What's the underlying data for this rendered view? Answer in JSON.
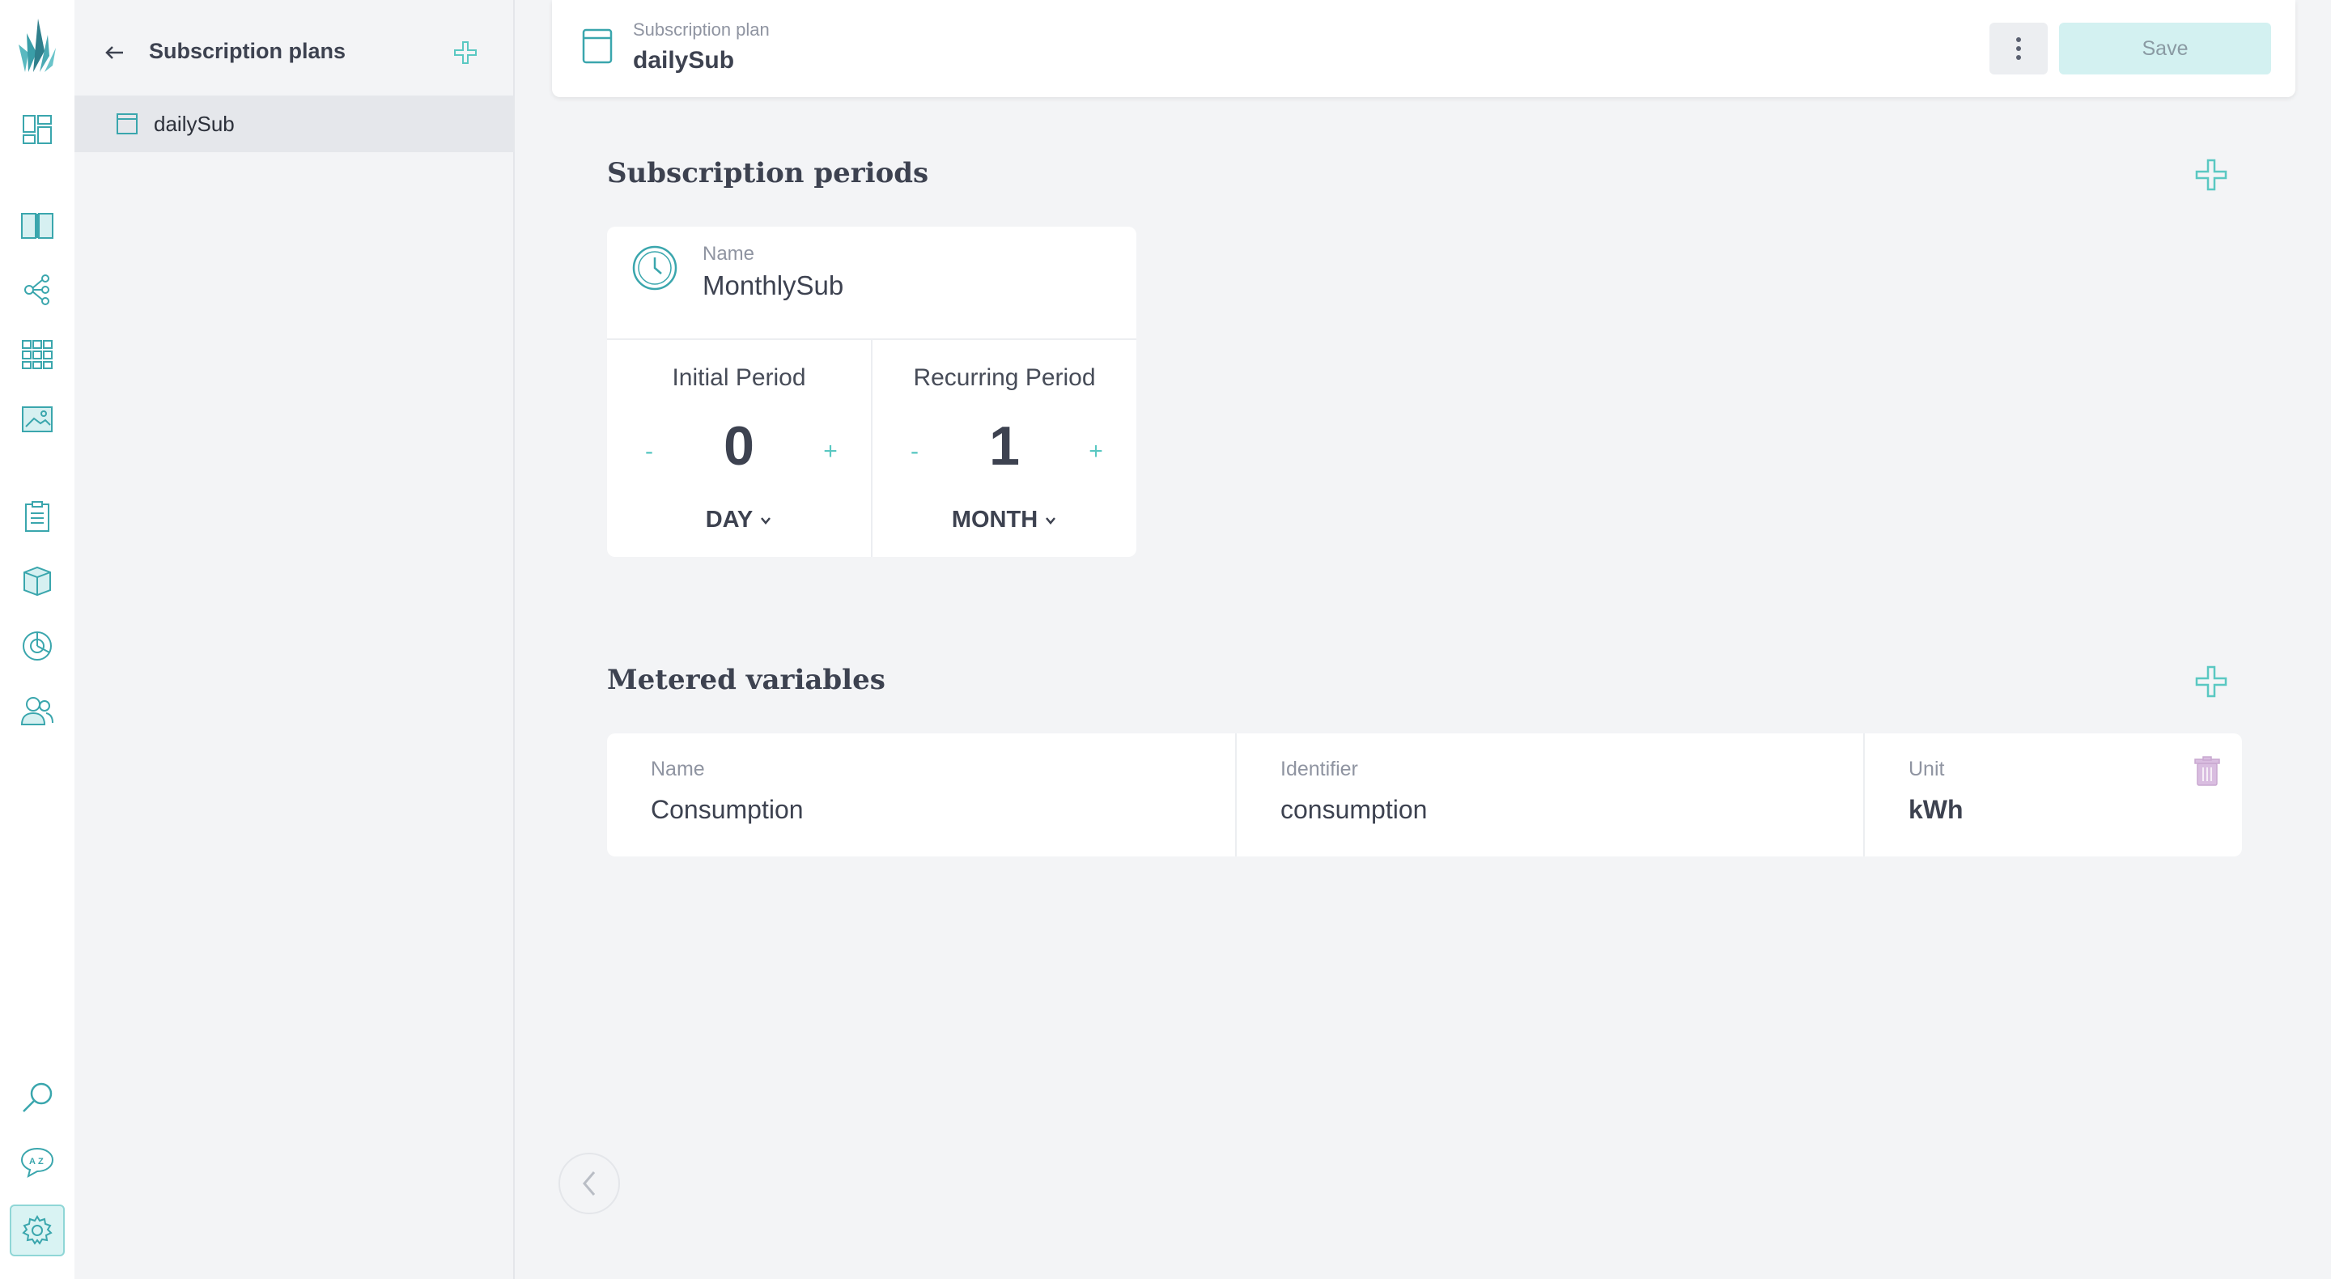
{
  "colors": {
    "accent": "#5ac8c2",
    "icon": "#3aa6ad",
    "save_bg": "#d3f1f1",
    "delete": "#c9a8d0"
  },
  "rail": {
    "icons": [
      "logo-icon",
      "dashboard-icon",
      "book-icon",
      "share-nodes-icon",
      "grid-icon",
      "image-icon",
      "clipboard-icon",
      "box-icon",
      "pie-chart-icon",
      "users-icon",
      "search-icon",
      "translate-icon",
      "settings-icon"
    ]
  },
  "panel": {
    "title": "Subscription plans",
    "items": [
      {
        "label": "dailySub"
      }
    ]
  },
  "topbar": {
    "caption": "Subscription plan",
    "title": "dailySub",
    "save_label": "Save"
  },
  "periods": {
    "section_title": "Subscription periods",
    "card": {
      "name_caption": "Name",
      "name": "MonthlySub",
      "initial": {
        "label": "Initial Period",
        "value": "0",
        "unit": "DAY",
        "minus": "-",
        "plus": "+"
      },
      "recurring": {
        "label": "Recurring Period",
        "value": "1",
        "unit": "MONTH",
        "minus": "-",
        "plus": "+"
      }
    }
  },
  "metered": {
    "section_title": "Metered variables",
    "columns": {
      "name": "Name",
      "identifier": "Identifier",
      "unit": "Unit"
    },
    "rows": [
      {
        "name": "Consumption",
        "identifier": "consumption",
        "unit": "kWh"
      }
    ]
  }
}
